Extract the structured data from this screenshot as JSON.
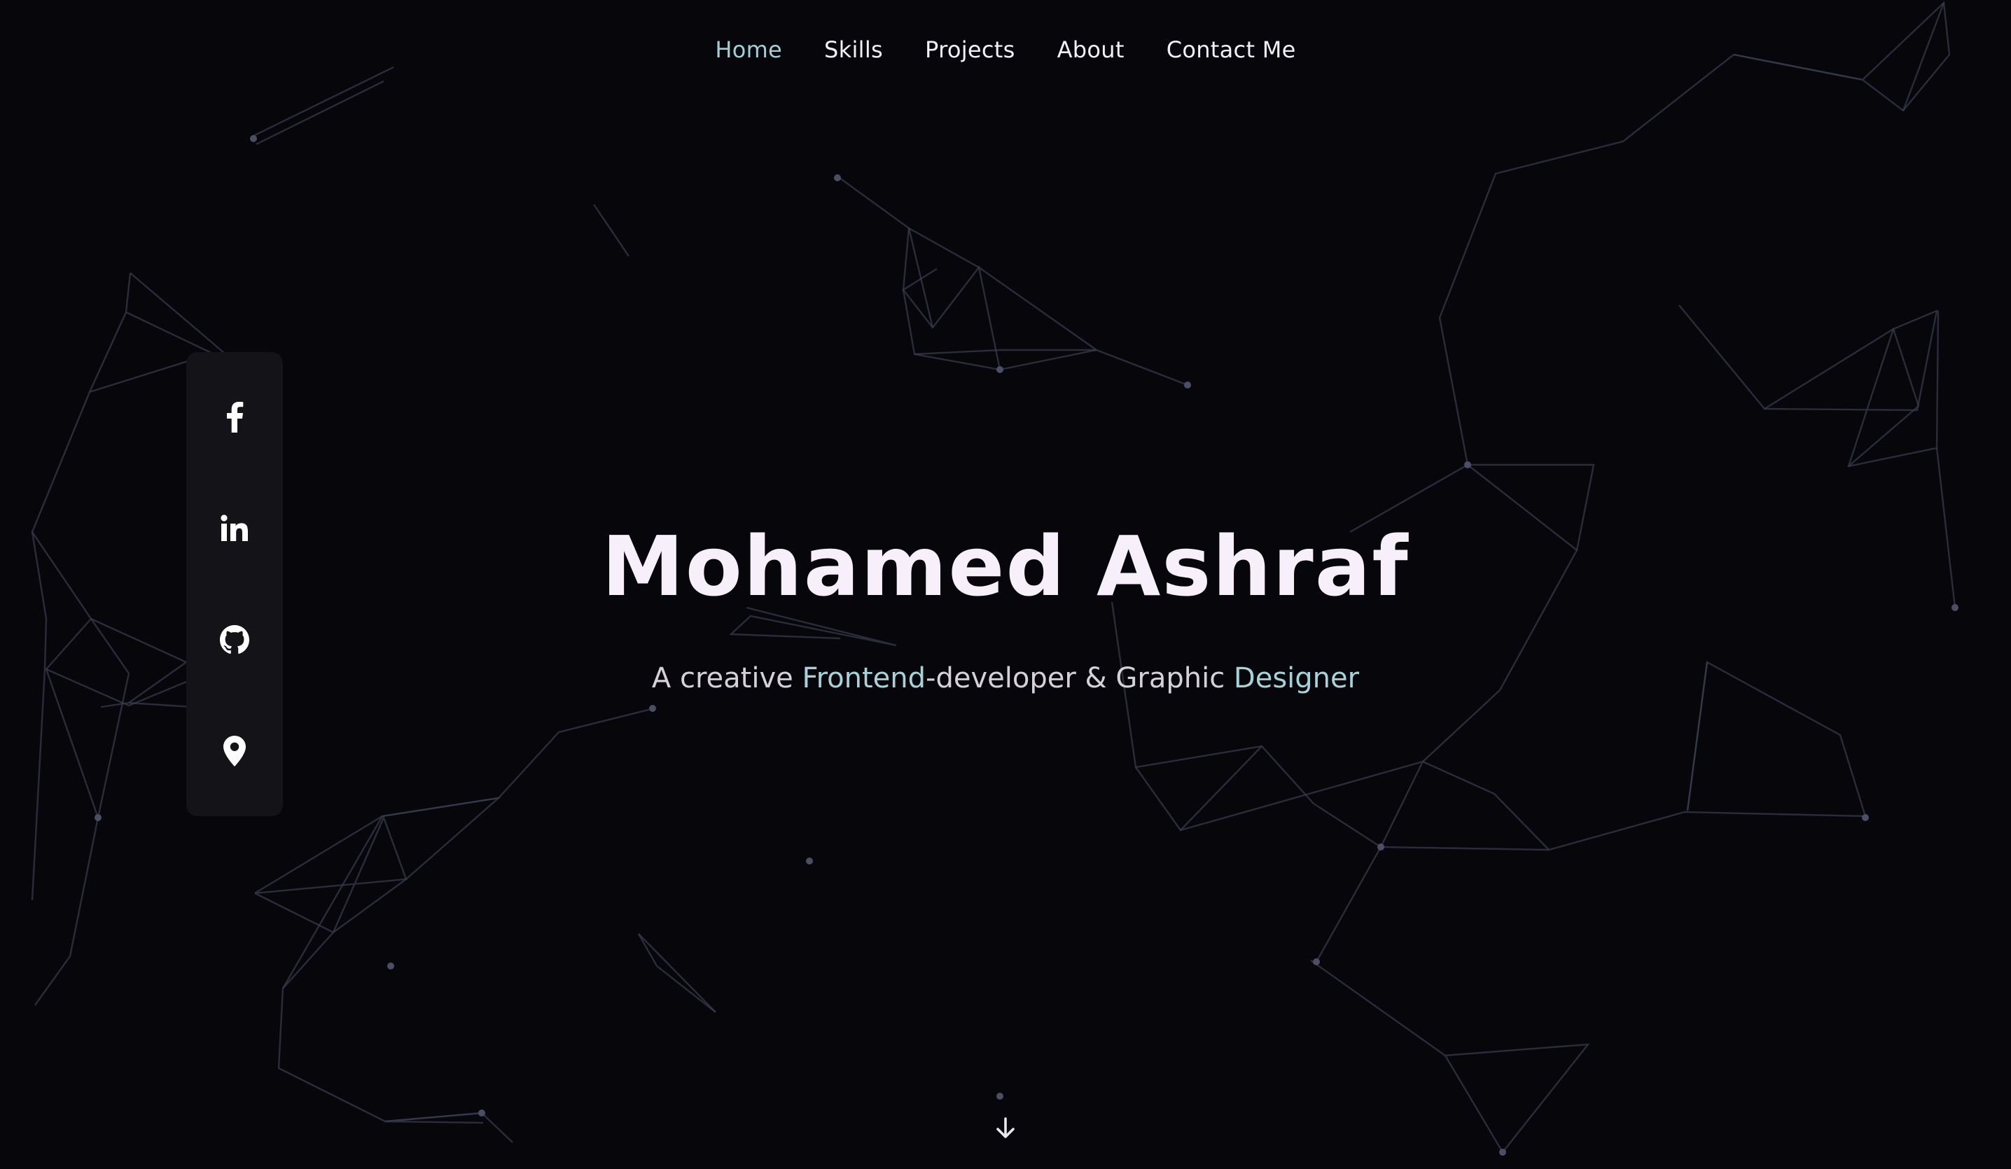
{
  "nav": {
    "items": [
      {
        "label": "Home",
        "active": true
      },
      {
        "label": "Skills",
        "active": false
      },
      {
        "label": "Projects",
        "active": false
      },
      {
        "label": "About",
        "active": false
      },
      {
        "label": "Contact Me",
        "active": false
      }
    ]
  },
  "social": {
    "icons": [
      "facebook-icon",
      "linkedin-icon",
      "github-icon",
      "location-pin-icon"
    ]
  },
  "hero": {
    "name": "Mohamed Ashraf",
    "subtitle": {
      "part1": "A creative ",
      "highlight1": "Frontend",
      "part2": "-developer & Graphic ",
      "highlight2": "Designer"
    }
  },
  "scroll": {
    "icon": "arrow-down-icon"
  },
  "colors": {
    "background": "#07060b",
    "accent": "#a6d3d9",
    "text": "#f3f1f8",
    "panel": "#141318",
    "network_line": "#3a3d4f"
  }
}
